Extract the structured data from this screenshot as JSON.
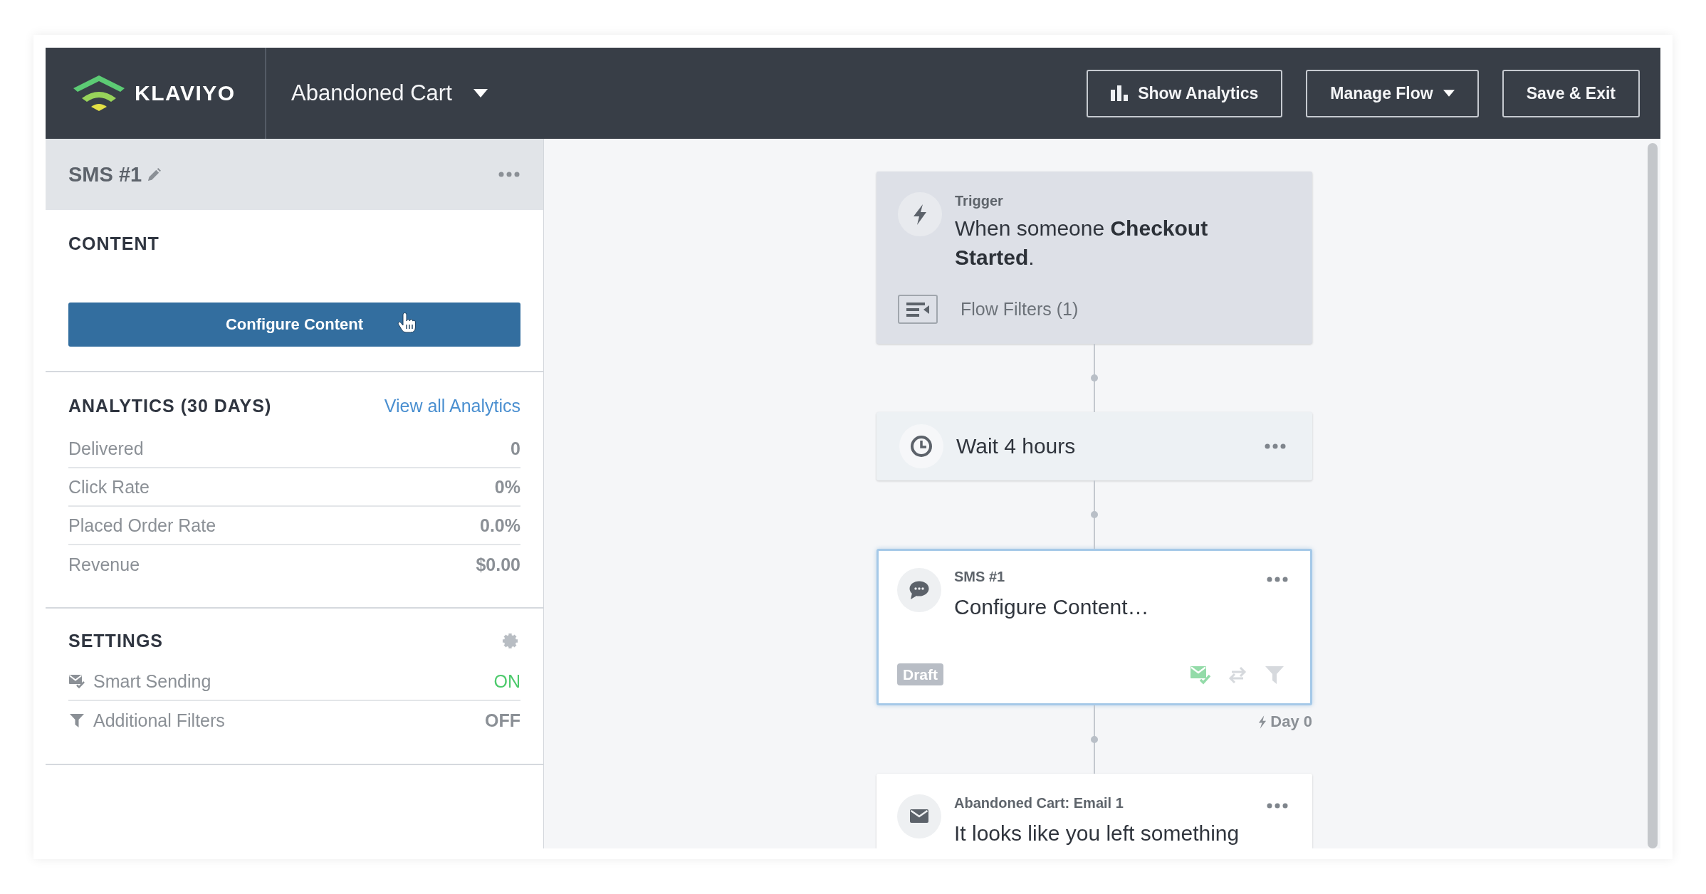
{
  "header": {
    "logo_text": "KLAVIYO",
    "flow_name": "Abandoned Cart",
    "buttons": [
      {
        "kind": "analytics",
        "label": "Show Analytics"
      },
      {
        "kind": "menu",
        "label": "Manage Flow"
      },
      {
        "kind": "save",
        "label": "Save & Exit"
      }
    ]
  },
  "sidebar": {
    "title": "SMS #1",
    "content": {
      "heading": "CONTENT",
      "button": "Configure Content"
    },
    "analytics": {
      "heading": "ANALYTICS (30 DAYS)",
      "link": "View all Analytics",
      "rows": [
        {
          "label": "Delivered",
          "value": "0"
        },
        {
          "label": "Click Rate",
          "value": "0%"
        },
        {
          "label": "Placed Order Rate",
          "value": "0.0%"
        },
        {
          "label": "Revenue",
          "value": "$0.00"
        }
      ]
    },
    "settings": {
      "heading": "SETTINGS",
      "rows": [
        {
          "kind": "smart_sending",
          "label": "Smart Sending",
          "value": "ON",
          "on": true
        },
        {
          "kind": "filter",
          "label": "Additional Filters",
          "value": "OFF",
          "on": false
        }
      ]
    }
  },
  "flow": {
    "nodes": [
      {
        "kind": "trigger",
        "selected": false,
        "label": "Trigger",
        "text": "When someone **Checkout Started**.",
        "filters": "Flow Filters (1)"
      },
      {
        "kind": "delay",
        "selected": false,
        "text": "Wait 4 hours"
      },
      {
        "kind": "sms",
        "selected": true,
        "label": "SMS #1",
        "text": "Configure Content…",
        "status": "Draft",
        "indicators": [
          {
            "kind": "smart_sending",
            "on": true
          },
          {
            "kind": "split",
            "on": false
          },
          {
            "kind": "filter",
            "on": false
          }
        ],
        "day": "Day 0"
      },
      {
        "kind": "email",
        "selected": false,
        "label": "Abandoned Cart: Email 1",
        "text": "It looks like you left something"
      }
    ]
  }
}
